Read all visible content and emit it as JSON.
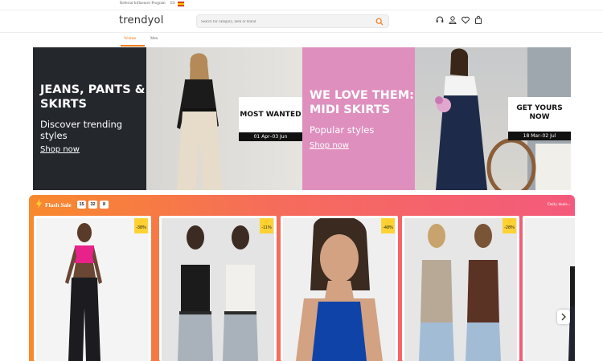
{
  "topbar": {
    "influencer": "Referral Influencer Program",
    "lang": "ES"
  },
  "header": {
    "logo": "trendyol",
    "search_placeholder": "Search for category, item or brand"
  },
  "catnav": {
    "women": "Women",
    "men": "Men"
  },
  "banner": {
    "panel1": {
      "headline1": "JEANS, PANTS &",
      "headline2": "SKIRTS",
      "sub1": "Discover trending",
      "sub2": "styles",
      "link": "Shop now"
    },
    "panel2": {
      "tag": "MOST WANTED",
      "date": "01 Apr–03 Jun"
    },
    "panel3": {
      "headline1": "WE LOVE THEM:",
      "headline2": "MIDI SKIRTS",
      "sub": "Popular styles",
      "link": "Shop now"
    },
    "panel4": {
      "tag1": "GET YOURS",
      "tag2": "NOW",
      "date": "18 Mar–02 Jul"
    }
  },
  "flash": {
    "title": "Flash Sale",
    "timer": [
      "15",
      "32",
      "8"
    ],
    "daily_deals": "Daily deals ›",
    "products": [
      {
        "discount": "-38%"
      },
      {
        "discount": "-11%"
      },
      {
        "discount": "-48%"
      },
      {
        "discount": "-28%"
      }
    ]
  },
  "colors": {
    "brand_orange": "#f27a1a",
    "flash_start": "#f8892d",
    "flash_end": "#f45a7c",
    "badge_yellow": "#ffd233",
    "banner_dark": "#24272c",
    "banner_pink": "#de8fbe"
  }
}
